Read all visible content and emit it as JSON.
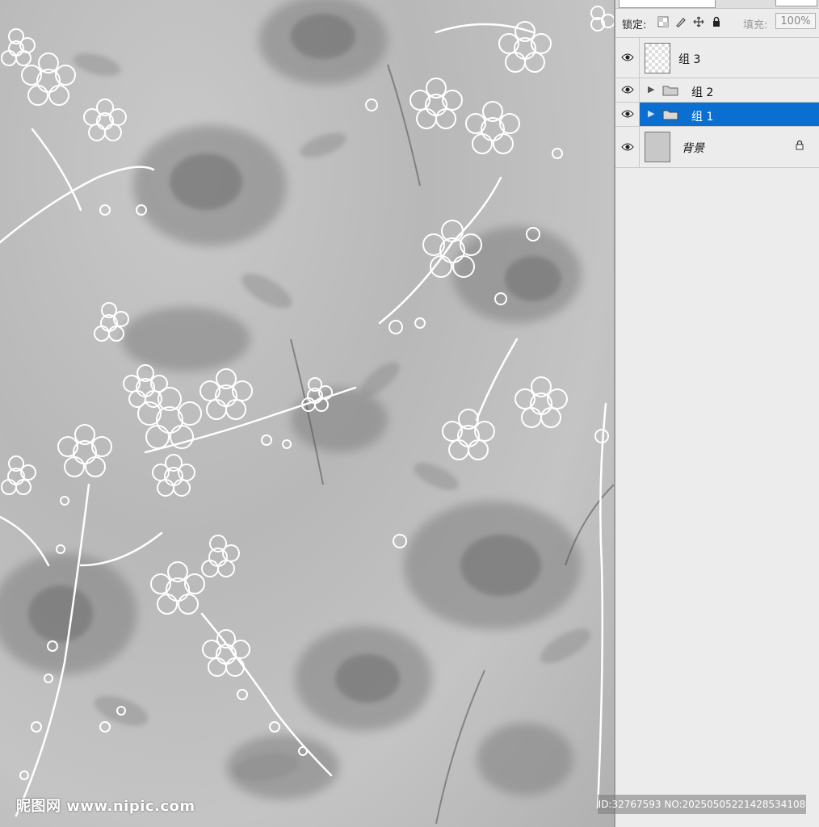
{
  "panel": {
    "lock_label": "锁定:",
    "fill_label": "填充:",
    "fill_value": "100%",
    "lock_icons": [
      "lock-transparent-icon",
      "lock-paint-icon",
      "lock-move-icon",
      "lock-all-icon"
    ],
    "layers": [
      {
        "name": "组 3",
        "type": "layer",
        "visible": true,
        "selected": false,
        "thumb": "transparent"
      },
      {
        "name": "组 2",
        "type": "group",
        "visible": true,
        "selected": false,
        "collapsed": true
      },
      {
        "name": "组 1",
        "type": "group",
        "visible": true,
        "selected": true,
        "collapsed": true
      },
      {
        "name": "背景",
        "type": "layer",
        "visible": true,
        "selected": false,
        "thumb": "gray",
        "locked": true
      }
    ]
  },
  "canvas": {
    "description_colors": {
      "background": "#c0c0c0",
      "ink": "#7a7a7a",
      "lines": "#ffffff"
    }
  },
  "watermark": {
    "site": "昵图网 www.nipic.com",
    "id_text": "ID:32767593 NO:20250505221428534108"
  },
  "colors": {
    "selection": "#0a6fd1",
    "panel_bg": "#ececec"
  }
}
